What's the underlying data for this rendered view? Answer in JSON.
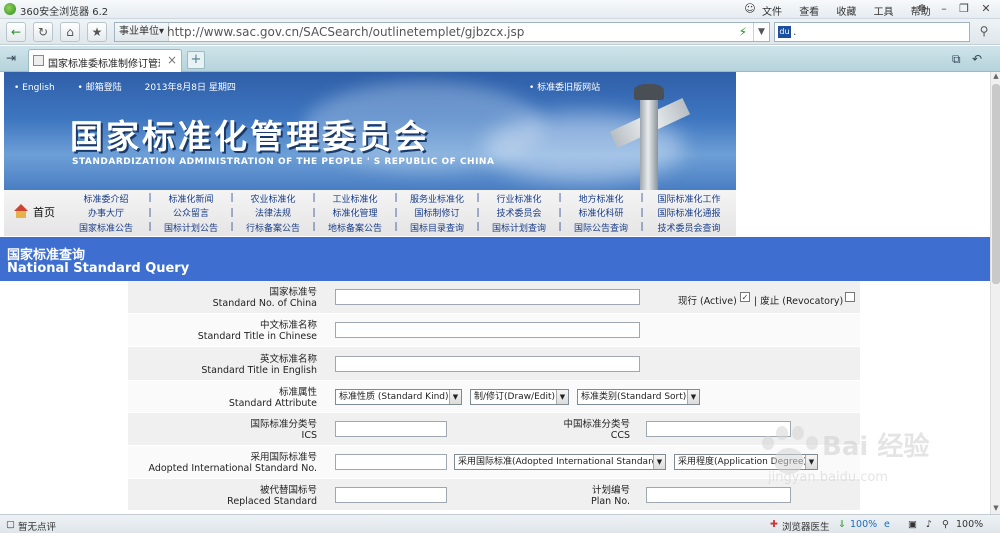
{
  "browser": {
    "title": "360安全浏览器 6.2",
    "menus": [
      "文件",
      "查看",
      "收藏",
      "工具",
      "帮助"
    ],
    "address_unit": "事业单位",
    "url": "http://www.sac.gov.cn/SACSearch/outlinetemplet/gjbzcx.jsp",
    "tab_title": "国家标准委标准制修订管理系统",
    "search_value": "."
  },
  "banner": {
    "top_links": [
      "English",
      "邮箱登陆",
      "2013年8月8日 星期四"
    ],
    "old_site": "标准委旧版网站",
    "title_cn": "国家标准化管理委员会",
    "title_en": "STANDARDIZATION ADMINISTRATION OF THE PEOPLE ' S REPUBLIC OF CHINA"
  },
  "menu": {
    "home": "首页",
    "rows": [
      [
        "标准委介绍",
        "标准化新闻",
        "农业标准化",
        "工业标准化",
        "服务业标准化",
        "行业标准化",
        "地方标准化",
        "国际标准化工作"
      ],
      [
        "办事大厅",
        "公众留言",
        "法律法规",
        "标准化管理",
        "国标制修订",
        "技术委员会",
        "标准化科研",
        "国际标准化通报"
      ],
      [
        "国家标准公告",
        "国标计划公告",
        "行标备案公告",
        "地标备案公告",
        "国标目录查询",
        "国标计划查询",
        "国际公告查询",
        "技术委员会查询"
      ]
    ]
  },
  "query": {
    "title_cn": "国家标准查询",
    "title_en": "National Standard Query"
  },
  "form": {
    "std_no_cn": "国家标准号",
    "std_no_en": "Standard No. of China",
    "active_label": "现行 (Active)",
    "active_checked": true,
    "revoked_label": "| 废止 (Revocatory)",
    "revoked_checked": false,
    "title_cn_cn": "中文标准名称",
    "title_cn_en": "Standard Title in Chinese",
    "title_en_cn": "英文标准名称",
    "title_en_en": "Standard Title in English",
    "attr_cn": "标准属性",
    "attr_en": "Standard Attribute",
    "attr_kind": "标准性质 (Standard Kind)",
    "attr_draw": "制/修订(Draw/Edit)",
    "attr_sort": "标准类别(Standard Sort)",
    "ics_cn": "国际标准分类号",
    "ics_en": "ICS",
    "ccs_cn": "中国标准分类号",
    "ccs_en": "CCS",
    "adopt_cn": "采用国际标准号",
    "adopt_en": "Adopted International Standard No.",
    "adopt_sel": "采用国际标准(Adopted International Standard)",
    "degree_sel": "采用程度(Application Degree)",
    "replaced_cn": "被代替国标号",
    "replaced_en": "Replaced Standard",
    "plan_cn": "计划编号",
    "plan_en": "Plan No."
  },
  "watermark": {
    "text": "Bai 经验",
    "url": "jingyan.baidu.com"
  },
  "status": {
    "comment": "暂无点评",
    "doctor": "浏览器医生",
    "speed": "100%",
    "zoom": "100%"
  }
}
